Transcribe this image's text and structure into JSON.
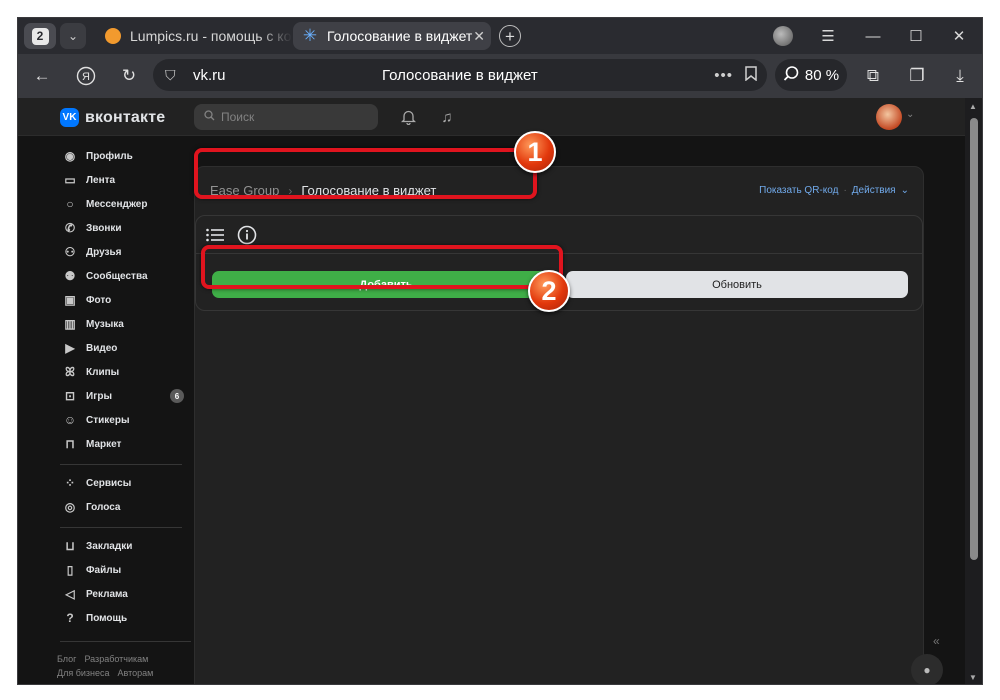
{
  "browser": {
    "tab_count": "2",
    "tabs": [
      {
        "title": "Lumpics.ru - помощь с ком",
        "close": "✕"
      },
      {
        "title": "Голосование в виджет",
        "close": "✕"
      }
    ],
    "new_tab": "+",
    "url": "vk.ru",
    "page_title": "Голосование в виджет",
    "zoom": "80 %",
    "omnibox_menu": "•••"
  },
  "vk": {
    "logo_text": "вконтакте",
    "logo_mark": "VK",
    "search_placeholder": "Поиск",
    "sidebar": {
      "group1": [
        "Профиль",
        "Лента",
        "Мессенджер",
        "Звонки",
        "Друзья",
        "Сообщества",
        "Фото",
        "Музыка",
        "Видео",
        "Клипы",
        "Игры",
        "Стикеры",
        "Маркет"
      ],
      "games_badge": "6",
      "group2": [
        "Сервисы",
        "Голоса"
      ],
      "group3": [
        "Закладки",
        "Файлы",
        "Реклама",
        "Помощь"
      ],
      "footer_row1": [
        "Блог",
        "Разработчикам"
      ],
      "footer_row2": [
        "Для бизнеса",
        "Авторам"
      ]
    },
    "breadcrumb": {
      "parent": "Ease Group",
      "current": "Голосование в виджет"
    },
    "actions": {
      "qr": "Показать QR-код",
      "menu": "Действия"
    },
    "buttons": {
      "add": "Добавить",
      "refresh": "Обновить"
    }
  },
  "annotations": {
    "marker1": "1",
    "marker2": "2",
    "highlight_color": "#e0141e"
  },
  "colors": {
    "vk_blue": "#0077ff",
    "add_green": "#3fae47",
    "link_blue": "#71aaeb"
  }
}
